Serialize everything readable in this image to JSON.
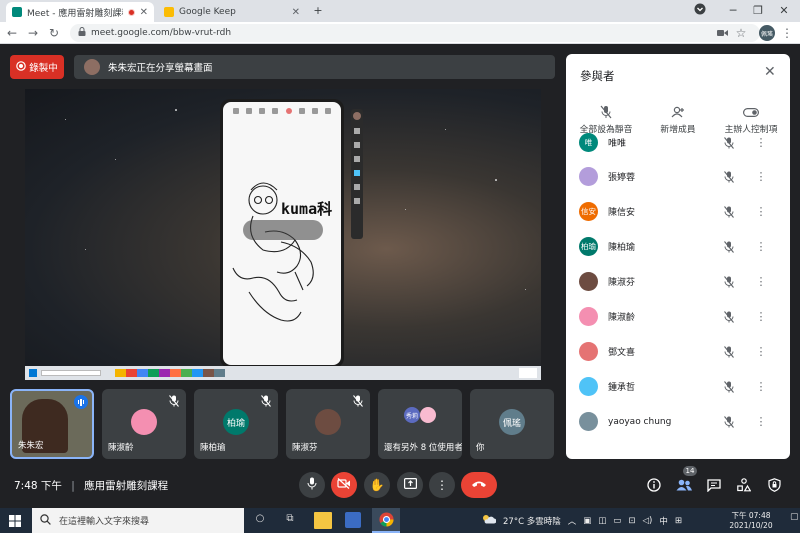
{
  "browser": {
    "tabs": [
      {
        "title": "Meet - 應用雷射雕刻課程",
        "favicon_color": "#00897b"
      },
      {
        "title": "Google Keep",
        "favicon_color": "#fbbc04"
      }
    ],
    "new_tab_icon": "plus-icon",
    "url": "meet.google.com/bbw-vrut-rdh",
    "profile_label": "佩瑤"
  },
  "meet": {
    "recording_label": "錄製中",
    "presenting_text": "朱朱宏正在分享螢幕畫面",
    "shared_screen": {
      "sketch_text": "kuma科"
    },
    "participants_panel": {
      "title": "參與者",
      "actions": [
        {
          "label": "全部設為靜音",
          "icon": "mic-off-icon"
        },
        {
          "label": "新增成員",
          "icon": "person-add-icon"
        },
        {
          "label": "主辦人控制項",
          "icon": "toggle-icon"
        }
      ],
      "people": [
        {
          "name": "唯唯",
          "avatar_text": "唯",
          "avatar_color": "#00897b"
        },
        {
          "name": "張婷蓉",
          "avatar_text": "",
          "avatar_color": "#b39ddb"
        },
        {
          "name": "陳信安",
          "avatar_text": "信安",
          "avatar_color": "#ef6c00"
        },
        {
          "name": "陳柏瑜",
          "avatar_text": "柏瑜",
          "avatar_color": "#00796b"
        },
        {
          "name": "陳淑芬",
          "avatar_text": "",
          "avatar_color": "#6d4c41"
        },
        {
          "name": "陳淑齡",
          "avatar_text": "",
          "avatar_color": "#f48fb1"
        },
        {
          "name": "鄧文喜",
          "avatar_text": "",
          "avatar_color": "#e57373"
        },
        {
          "name": "鍾承哲",
          "avatar_text": "",
          "avatar_color": "#4fc3f7"
        },
        {
          "name": "yaoyao chung",
          "avatar_text": "",
          "avatar_color": "#78909c"
        }
      ]
    },
    "tiles": [
      {
        "name": "朱朱宏",
        "avatar_text": "",
        "avatar_color": "#6b6a5a"
      },
      {
        "name": "陳淑齡",
        "avatar_text": "",
        "avatar_color": "#f48fb1"
      },
      {
        "name": "陳柏瑜",
        "avatar_text": "柏瑜",
        "avatar_color": "#00796b"
      },
      {
        "name": "陳淑芬",
        "avatar_text": "",
        "avatar_color": "#6d4c41"
      },
      {
        "name": "還有另外 8 位使用者",
        "avatar_text": "秀莉",
        "avatar_color": "#5c6bc0"
      },
      {
        "name": "你",
        "avatar_text": "佩瑤",
        "avatar_color": "#607d8b"
      }
    ],
    "time": "7:48 下午",
    "meeting_title": "應用雷射雕刻課程",
    "participant_count": "14",
    "colors": {
      "accent_red": "#ea4335",
      "panel_bg": "#ffffff",
      "meet_bg": "#202124"
    }
  },
  "taskbar": {
    "search_placeholder": "在這裡輸入文字來搜尋",
    "weather": "27°C 多雲時陰",
    "ime": "中",
    "time": "下午 07:48",
    "date": "2021/10/20"
  }
}
